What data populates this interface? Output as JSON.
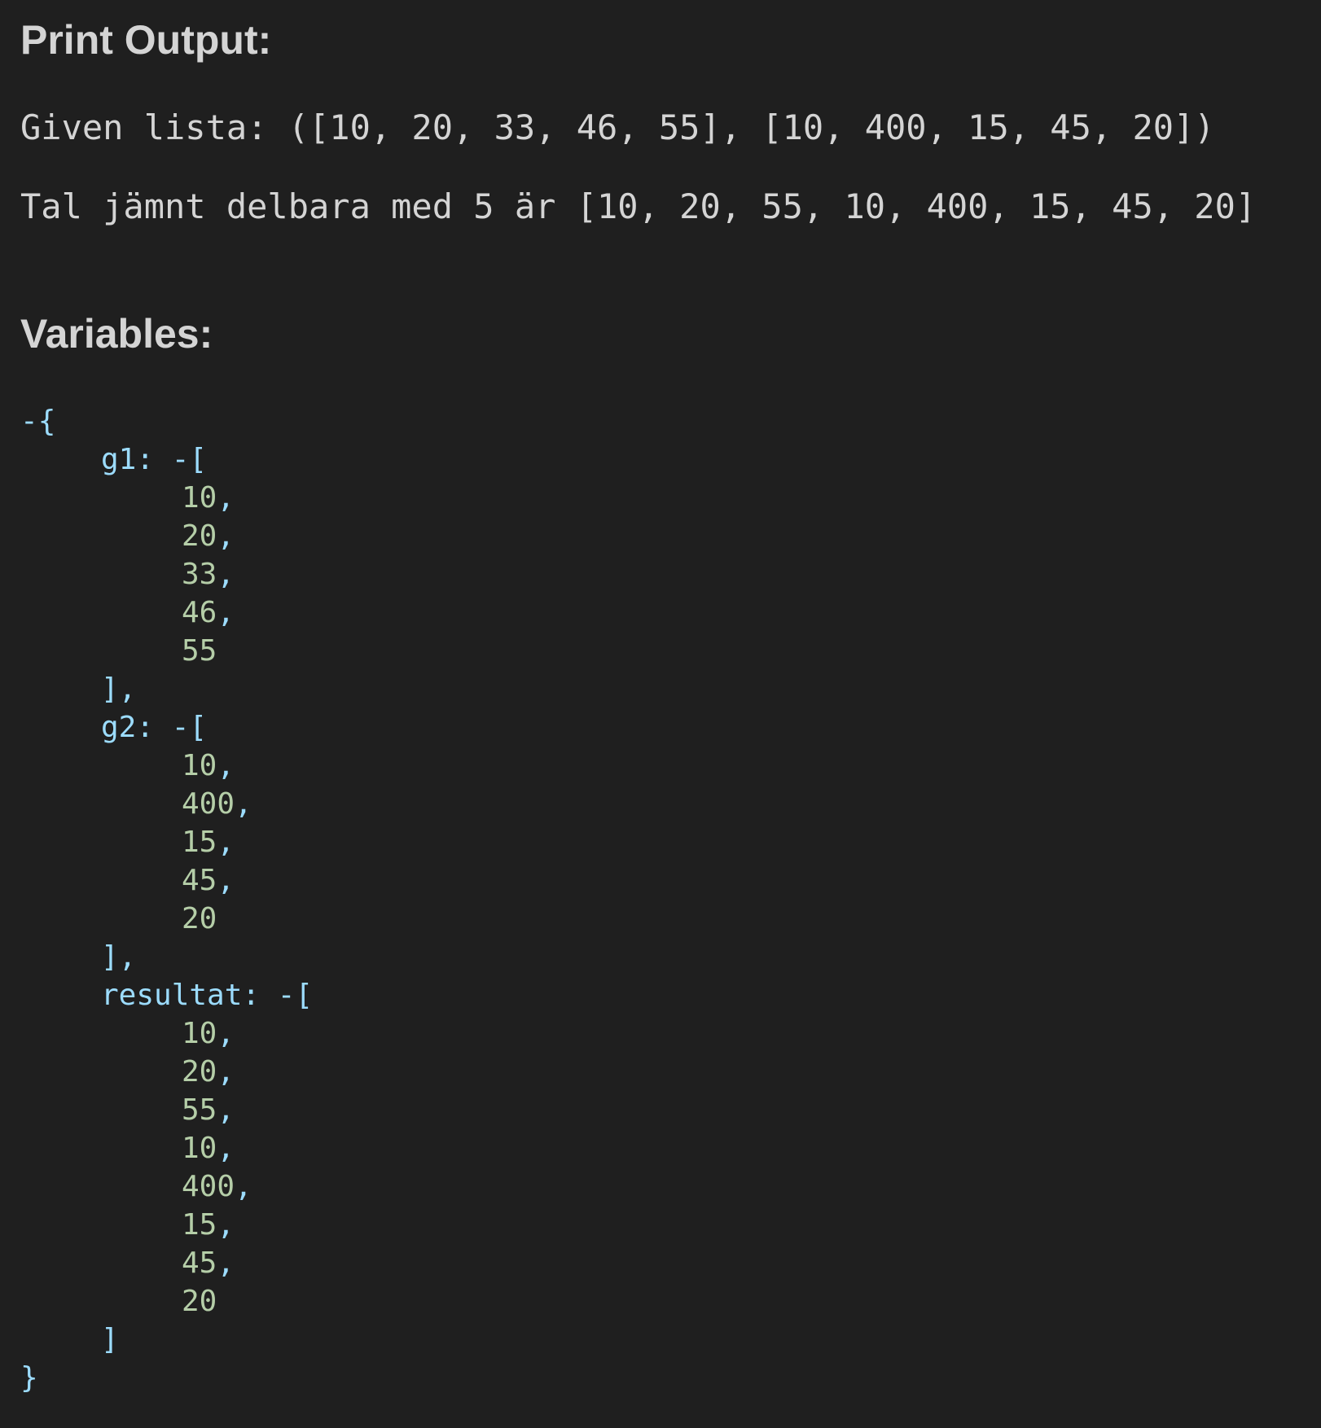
{
  "print_output": {
    "heading": "Print Output:",
    "lines": [
      "Given lista: ([10, 20, 33, 46, 55], [10, 400, 15, 45, 20])",
      "Tal jämnt delbara med 5 är [10, 20, 55, 10, 400, 15, 45, 20]"
    ]
  },
  "variables": {
    "heading": "Variables:",
    "toggle_symbol": "-",
    "open_brace": "{",
    "close_brace": "}",
    "open_bracket": "[",
    "items": [
      {
        "key": "g1:",
        "values": [
          "10",
          "20",
          "33",
          "46",
          "55"
        ],
        "close": "],"
      },
      {
        "key": "g2:",
        "values": [
          "10",
          "400",
          "15",
          "45",
          "20"
        ],
        "close": "],"
      },
      {
        "key": "resultat:",
        "values": [
          "10",
          "20",
          "55",
          "10",
          "400",
          "15",
          "45",
          "20"
        ],
        "close": "]"
      }
    ]
  }
}
